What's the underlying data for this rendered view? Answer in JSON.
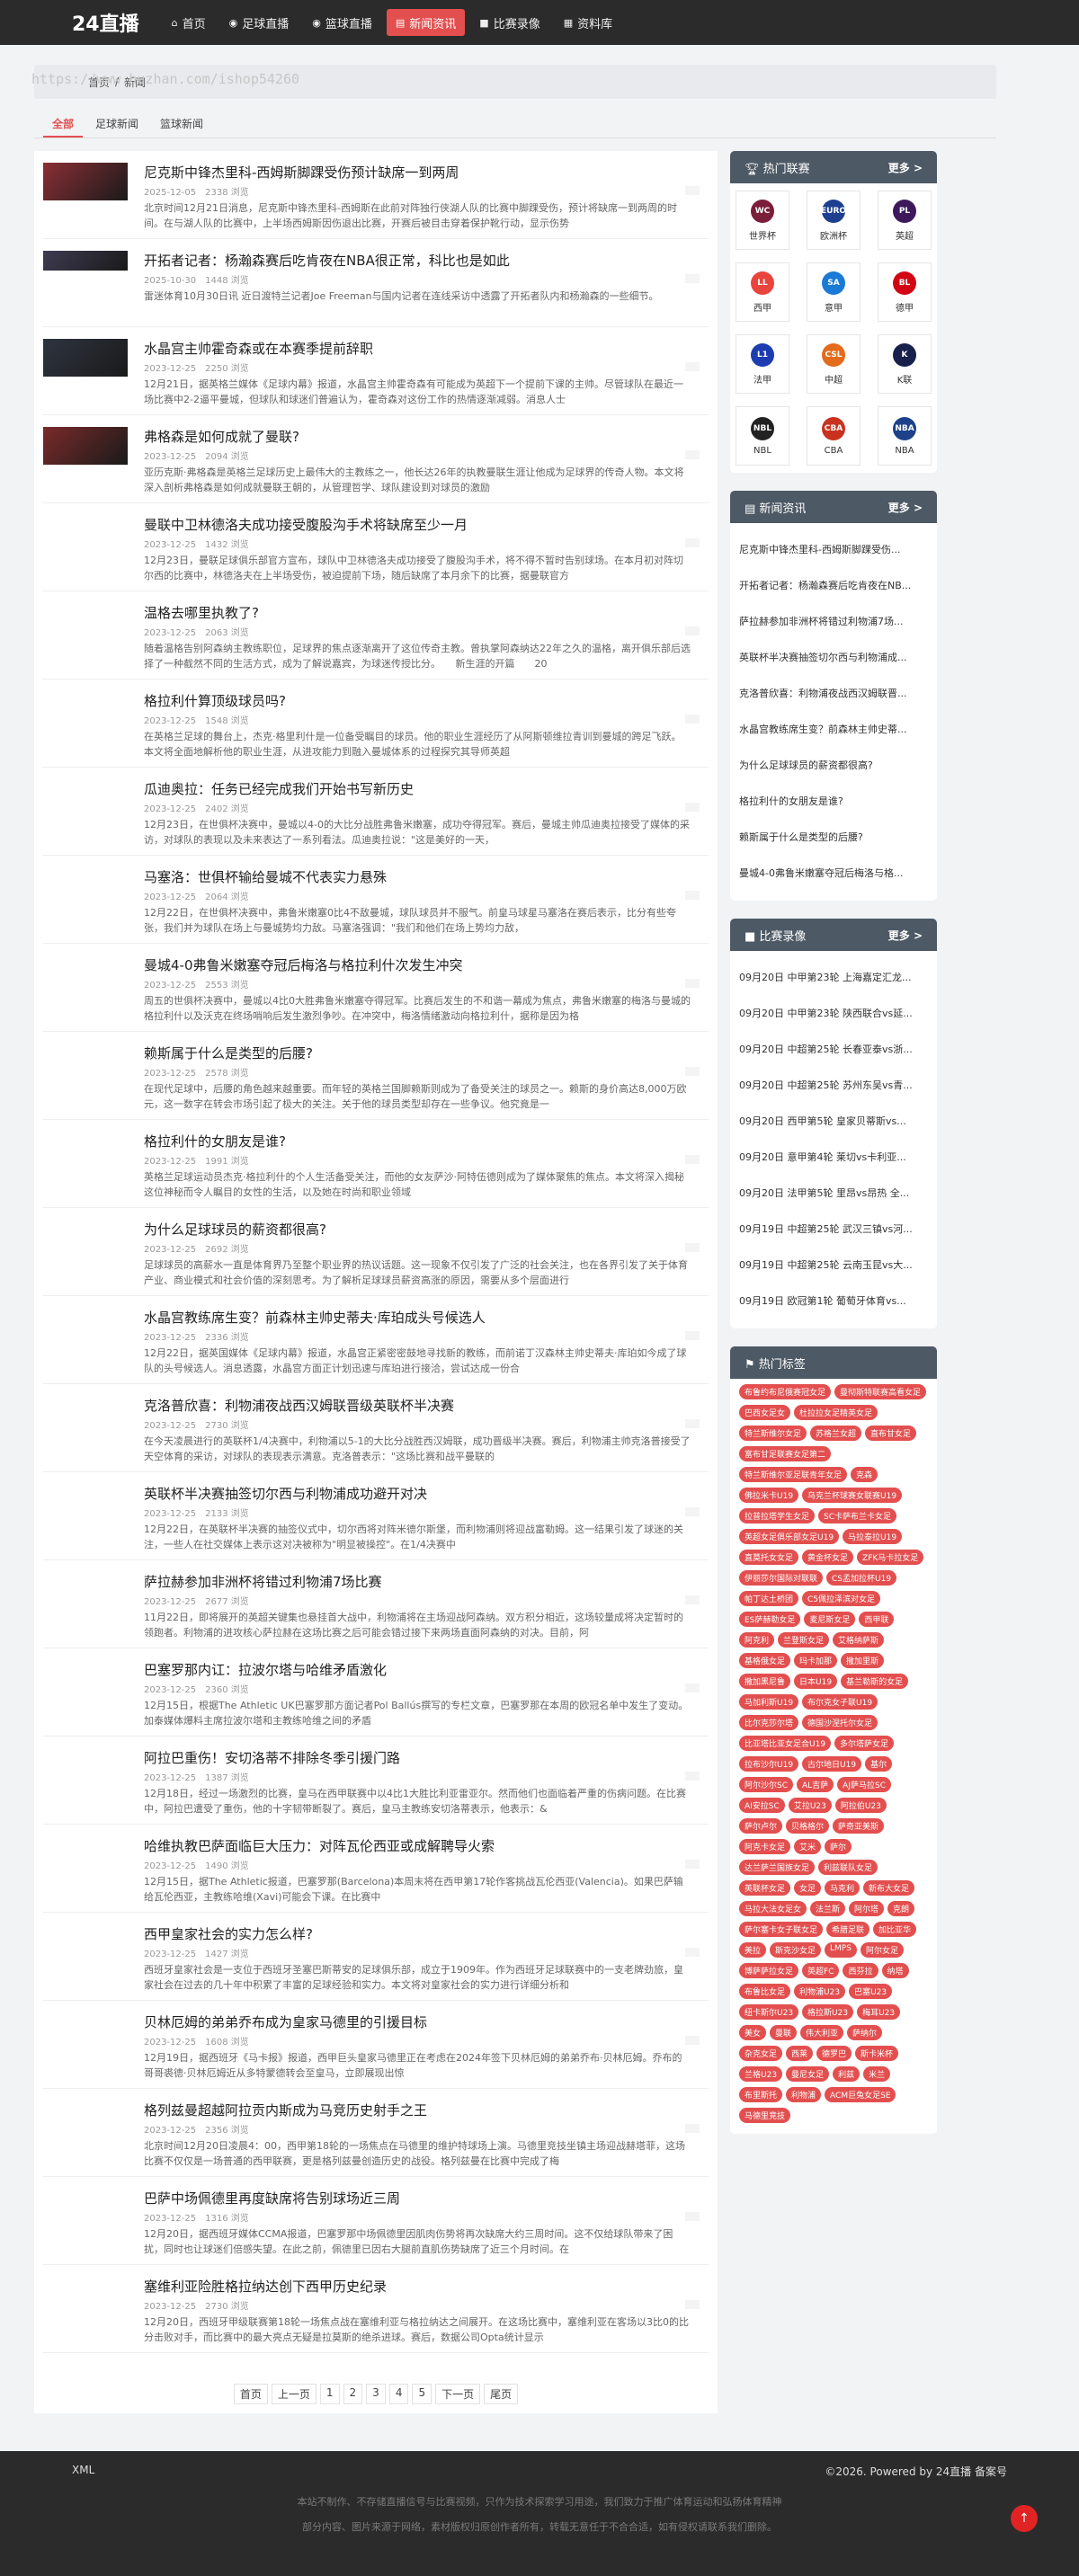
{
  "header": {
    "logo": "24直播",
    "nav": [
      {
        "label": "首页",
        "icon": "home-icon",
        "glyph": "⌂"
      },
      {
        "label": "足球直播",
        "icon": "football-icon",
        "glyph": "◉"
      },
      {
        "label": "篮球直播",
        "icon": "basketball-icon",
        "glyph": "◉"
      },
      {
        "label": "新闻资讯",
        "icon": "news-icon",
        "glyph": "▤",
        "active": true
      },
      {
        "label": "比赛录像",
        "icon": "video-icon",
        "glyph": "■"
      },
      {
        "label": "资料库",
        "icon": "database-icon",
        "glyph": "▦"
      }
    ]
  },
  "watermark": "https://www.huzhan.com/ishop54260",
  "breadcrumb": {
    "home": "首页",
    "sep": "/",
    "current": "新闻"
  },
  "tabs": [
    {
      "label": "全部",
      "active": true
    },
    {
      "label": "足球新闻"
    },
    {
      "label": "篮球新闻"
    }
  ],
  "articles": [
    {
      "title": "尼克斯中锋杰里科-西姆斯脚踝受伤预计缺席一到两周",
      "date": "2025-12-05",
      "views": "2338 浏览",
      "summary": "北京时间12月21日消息，尼克斯中锋杰里科-西姆斯在此前对阵独行侠湖人队的比赛中脚踝受伤，预计将缺席一到两周的时间。在与湖人队的比赛中，上半场西姆斯因伤退出比赛，开赛后被目击穿着保护靴行动，显示伤势",
      "thumb": "#8a2f35"
    },
    {
      "title": "开拓者记者：杨瀚森赛后吃肯夜在NBA很正常，科比也是如此",
      "date": "2025-10-30",
      "views": "1448 浏览",
      "summary": "雷迷体育10月30日讯 近日渡特兰记者Joe Freeman与国内记者在连线采访中透露了开拓者队内和杨瀚森的一些细节。",
      "thumb": "#3f3b52"
    },
    {
      "title": "水晶宫主帅霍奇森或在本赛季提前辞职",
      "date": "2023-12-25",
      "views": "2250 浏览",
      "summary": "12月21日，据英格兰媒体《足球内幕》报道，水晶宫主帅霍奇森有可能成为英超下一个提前下课的主帅。尽管球队在最近一场比赛中2-2逼平曼城，但球队和球迷们普遍认为，霍奇森对这份工作的热情逐渐减弱。消息人士",
      "thumb": "#2e3440"
    },
    {
      "title": "弗格森是如何成就了曼联?",
      "date": "2023-12-25",
      "views": "2094 浏览",
      "summary": "亚历克斯·弗格森是英格兰足球历史上最伟大的主教练之一，他长达26年的执教曼联生涯让他成为足球界的传奇人物。本文将深入剖析弗格森是如何成就曼联王朝的，从管理哲学、球队建设到对球员的激励",
      "thumb": "#7a2a2a"
    },
    {
      "title": "曼联中卫林德洛夫成功接受腹股沟手术将缺席至少一月",
      "date": "2023-12-25",
      "views": "1432 浏览",
      "summary": "12月23日，曼联足球俱乐部官方宣布，球队中卫林德洛夫成功接受了腹股沟手术，将不得不暂时告别球场。在本月初对阵切尔西的比赛中，林德洛夫在上半场受伤，被迫提前下场，随后缺席了本月余下的比赛，据曼联官方",
      "thumb": null
    },
    {
      "title": "温格去哪里执教了?",
      "date": "2023-12-25",
      "views": "2063 浏览",
      "summary": "随着温格告别阿森纳主教练职位，足球界的焦点逐渐离开了这位传奇主教。曾执掌阿森纳达22年之久的温格，离开俱乐部后选择了一种截然不同的生活方式，成为了解说嘉宾，为球迷传授比分。　　新生涯的开篇　　20",
      "thumb": null
    },
    {
      "title": "格拉利什算顶级球员吗?",
      "date": "2023-12-25",
      "views": "1548 浏览",
      "summary": "在英格兰足球的舞台上，杰克·格里利什是一位备受瞩目的球员。他的职业生涯经历了从阿斯顿维拉青训到曼城的跨足飞跃。本文将全面地解析他的职业生涯，从进攻能力到融入曼城体系的过程探究其导师英超",
      "thumb": null
    },
    {
      "title": "瓜迪奥拉：任务已经完成我们开始书写新历史",
      "date": "2023-12-25",
      "views": "2402 浏览",
      "summary": "12月23日，在世俱杯决赛中，曼城以4-0的大比分战胜弗鲁米嫩塞，成功夺得冠军。赛后，曼城主帅瓜迪奥拉接受了媒体的采访，对球队的表现以及未来表达了一系列看法。瓜迪奥拉说：\"这是美好的一天，",
      "thumb": null
    },
    {
      "title": "马塞洛：世俱杯输给曼城不代表实力悬殊",
      "date": "2023-12-25",
      "views": "2064 浏览",
      "summary": "12月22日，在世俱杯决赛中，弗鲁米嫩塞0比4不敌曼城，球队球员并不服气。前皇马球星马塞洛在赛后表示，比分有些夸张，我们并为球队在场上与曼城势均力敌。马塞洛强调：\"我们和他们在场上势均力敌，",
      "thumb": null
    },
    {
      "title": "曼城4-0弗鲁米嫩塞夺冠后梅洛与格拉利什次发生冲突",
      "date": "2023-12-25",
      "views": "2553 浏览",
      "summary": "周五的世俱杯决赛中，曼城以4比0大胜弗鲁米嫩塞夺得冠军。比赛后发生的不和谐一幕成为焦点，弗鲁米嫩塞的梅洛与曼城的格拉利什以及沃克在终场哨响后发生激烈争吵。在冲突中，梅洛情绪激动向格拉利什，据称是因为格",
      "thumb": null
    },
    {
      "title": "赖斯属于什么是类型的后腰?",
      "date": "2023-12-25",
      "views": "2578 浏览",
      "summary": "在现代足球中，后腰的角色越来越重要。而年轻的英格兰国脚赖斯则成为了备受关注的球员之一。赖斯的身价高达8,000万欧元，这一数字在转会市场引起了极大的关注。关于他的球员类型却存在一些争议。他究竟是一",
      "thumb": null
    },
    {
      "title": "格拉利什的女朋友是谁?",
      "date": "2023-12-25",
      "views": "1991 浏览",
      "summary": "英格兰足球运动员杰克·格拉利什的个人生活备受关注，而他的女友萨沙·阿特伍德则成为了媒体聚焦的焦点。本文将深入揭秘这位神秘而令人瞩目的女性的生活，以及她在时尚和职业领域",
      "thumb": null
    },
    {
      "title": "为什么足球球员的薪资都很高?",
      "date": "2023-12-25",
      "views": "2692 浏览",
      "summary": "足球球员的高薪水一直是体育界乃至整个职业界的热议话题。这一现象不仅引发了广泛的社会关注，也在各界引发了关于体育产业、商业模式和社会价值的深刻思考。为了解析足球球员薪资高涨的原因，需要从多个层面进行",
      "thumb": null
    },
    {
      "title": "水晶宫教练席生变？前森林主帅史蒂夫·库珀成头号候选人",
      "date": "2023-12-25",
      "views": "2336 浏览",
      "summary": "12月22日，据英国媒体《足球内幕》报道，水晶宫正紧密密鼓地寻找新的教练，而前诺丁汉森林主帅史蒂夫·库珀如今成了球队的头号候选人。消息透露，水晶宫方面正计划迅速与库珀进行接洽，尝试达成一份合",
      "thumb": null
    },
    {
      "title": "克洛普欣喜：利物浦夜战西汉姆联晋级英联杯半决赛",
      "date": "2023-12-25",
      "views": "2730 浏览",
      "summary": "在今天凌晨进行的英联杯1/4决赛中，利物浦以5-1的大比分战胜西汉姆联，成功晋级半决赛。赛后，利物浦主帅克洛普接受了天空体育的采访，对球队的表现表示满意。克洛普表示：\"这场比赛和战平曼联的",
      "thumb": null
    },
    {
      "title": "英联杯半决赛抽签切尔西与利物浦成功避开对决",
      "date": "2023-12-25",
      "views": "2133 浏览",
      "summary": "12月22日，在英联杯半决赛的抽签仪式中，切尔西将对阵米德尔斯堡，而利物浦则将迎战富勒姆。这一结果引发了球迷的关注，一些人在社交媒体上表示这对决被称为\"明显被操控\"。在1/4决赛中",
      "thumb": null
    },
    {
      "title": "萨拉赫参加非洲杯将错过利物浦7场比赛",
      "date": "2023-12-25",
      "views": "2677 浏览",
      "summary": "11月22日，即将展开的英超关键集也悬挂首大战中，利物浦将在主场迎战阿森纳。双方积分相近，这场较量成将决定暂时的领跑者。利物浦的进攻核心萨拉赫在这场比赛之后可能会错过接下来两场直面阿森纳的对决。目前，阿",
      "thumb": null
    },
    {
      "title": "巴塞罗那内讧：拉波尔塔与哈维矛盾激化",
      "date": "2023-12-25",
      "views": "2360 浏览",
      "summary": "12月15日，根据The Athletic UK巴塞罗那方面记者Pol Ballús撰写的专栏文章，巴塞罗那在本周的欧冠名单中发生了变动。加泰媒体爆料主席拉波尔塔和主教练哈维之间的矛盾",
      "thumb": null
    },
    {
      "title": "阿拉巴重伤！安切洛蒂不排除冬季引援门路",
      "date": "2023-12-25",
      "views": "1387 浏览",
      "summary": "12月18日，经过一场激烈的比赛，皇马在西甲联赛中以4比1大胜比利亚雷亚尔。然而他们也面临着严重的伤病问题。在比赛中，阿拉巴遭受了重伤，他的十字韧带断裂了。赛后，皇马主教练安切洛蒂表示，他表示：&",
      "thumb": null
    },
    {
      "title": "哈维执教巴萨面临巨大压力：对阵瓦伦西亚或成解聘导火索",
      "date": "2023-12-25",
      "views": "1490 浏览",
      "summary": "12月15日，据The Athletic报道，巴塞罗那(Barcelona)本周末将在西甲第17轮作客挑战瓦伦西亚(Valencia)。如果巴萨输给瓦伦西亚，主教练哈维(Xavi)可能会下课。在比赛中",
      "thumb": null
    },
    {
      "title": "西甲皇家社会的实力怎么样?",
      "date": "2023-12-25",
      "views": "1427 浏览",
      "summary": "西班牙皇家社会是一支位于西班牙圣塞巴斯蒂安的足球俱乐部，成立于1909年。作为西班牙足球联赛中的一支老牌劲旅，皇家社会在过去的几十年中积累了丰富的足球经验和实力。本文将对皇家社会的实力进行详细分析和",
      "thumb": null
    },
    {
      "title": "贝林厄姆的弟弟乔布成为皇家马德里的引援目标",
      "date": "2023-12-25",
      "views": "1608 浏览",
      "summary": "12月19日，据西班牙《马卡报》报道，西甲巨头皇家马德里正在考虑在2024年签下贝林厄姆的弟弟乔布·贝林厄姆。乔布的哥哥裘德·贝林厄姆近从多特蒙德转会至皇马，立即展现出惊",
      "thumb": null
    },
    {
      "title": "格列兹曼超越阿拉贡内斯成为马竞历史射手之王",
      "date": "2023-12-25",
      "views": "2356 浏览",
      "summary": "北京时间12月20日凌晨4：00，西甲第18轮的一场焦点在马德里的维护特球场上演。马德里竞技坐镇主场迎战赫塔菲，这场比赛不仅仅是一场普通的西甲联赛，更是格列兹曼创造历史的战役。格列兹曼在比赛中完成了梅",
      "thumb": null
    },
    {
      "title": "巴萨中场佩德里再度缺席将告别球场近三周",
      "date": "2023-12-25",
      "views": "1316 浏览",
      "summary": "12月20日，据西班牙媒体CCMA报道，巴塞罗那中场佩德里因肌肉伤势将再次缺席大约三周时间。这不仅给球队带来了困扰，同时也让球迷们倍感失望。在此之前，佩德里已因右大腿前直肌伤势缺席了近三个月时间。在",
      "thumb": null
    },
    {
      "title": "塞维利亚险胜格拉纳达创下西甲历史纪录",
      "date": "2023-12-25",
      "views": "2730 浏览",
      "summary": "12月20日，西班牙甲级联赛第18轮一场焦点战在塞维利亚与格拉纳达之间展开。在这场比赛中，塞维利亚在客场以3比0的比分击败对手，而比赛中的最大亮点无疑是拉莫斯的绝杀进球。赛后，数据公司Opta统计显示",
      "thumb": null
    }
  ],
  "pager": [
    "首页",
    "上一页",
    "1",
    "2",
    "3",
    "4",
    "5",
    "下一页",
    "尾页"
  ],
  "sidebar": {
    "hot_leagues": {
      "title": "热门联赛",
      "more": "更多 >",
      "items": [
        {
          "name": "世界杯",
          "short": "WC",
          "color": "#7b1e3a"
        },
        {
          "name": "欧洲杯",
          "short": "EURO",
          "color": "#1e3f8f"
        },
        {
          "name": "英超",
          "short": "PL",
          "color": "#3d195b"
        },
        {
          "name": "西甲",
          "short": "LL",
          "color": "#e8443d"
        },
        {
          "name": "意甲",
          "short": "SA",
          "color": "#1a7bd6"
        },
        {
          "name": "德甲",
          "short": "BL",
          "color": "#d20515"
        },
        {
          "name": "法甲",
          "short": "L1",
          "color": "#1d3cb0"
        },
        {
          "name": "中超",
          "short": "CSL",
          "color": "#e46b1c"
        },
        {
          "name": "K联",
          "short": "K",
          "color": "#16204a"
        },
        {
          "name": "NBL",
          "short": "NBL",
          "color": "#222"
        },
        {
          "name": "CBA",
          "short": "CBA",
          "color": "#c8321e"
        },
        {
          "name": "NBA",
          "short": "NBA",
          "color": "#1d428a"
        }
      ]
    },
    "news": {
      "title": "新闻资讯",
      "more": "更多 >",
      "items": [
        "尼克斯中锋杰里科-西姆斯脚踝受伤...",
        "开拓者记者：杨瀚森赛后吃肯夜在NB...",
        "萨拉赫参加非洲杯将错过利物浦7场...",
        "英联杯半决赛抽签切尔西与利物浦成...",
        "克洛普欣喜：利物浦夜战西汉姆联晋...",
        "水晶宫教练席生变？前森林主帅史蒂...",
        "为什么足球球员的薪资都很高?",
        "格拉利什的女朋友是谁?",
        "赖斯属于什么是类型的后腰?",
        "曼城4-0弗鲁米嫩塞夺冠后梅洛与格..."
      ]
    },
    "videos": {
      "title": "比赛录像",
      "more": "更多 >",
      "items": [
        "09月20日 中甲第23轮 上海嘉定汇龙...",
        "09月20日 中甲第23轮 陕西联合vs延...",
        "09月20日 中超第25轮 长春亚泰vs浙...",
        "09月20日 中超第25轮 苏州东吴vs青...",
        "09月20日 西甲第5轮 皇家贝蒂斯vs...",
        "09月20日 意甲第4轮 莱切vs卡利亚...",
        "09月20日 法甲第5轮 里昂vs昂热 全...",
        "09月19日 中超第25轮 武汉三镇vs河...",
        "09月19日 中超第25轮 云南玉昆vs大...",
        "09月19日 欧冠第1轮 葡萄牙体育vs..."
      ]
    },
    "tags": {
      "title": "热门标签",
      "items": [
        "布鲁约布尼俄赛冠女足",
        "曼彻斯特联赛高看女足",
        "巴西女足女",
        "杜拉拉女足精英女足",
        "特兰斯维尔女足",
        "苏格兰女超",
        "直布甘女足",
        "富布甘足联赛女足第二",
        "特兰斯维尔亚足联青年女足",
        "克森",
        "佛拉米卡U19",
        "乌克兰杯球赛女联赛U19",
        "拉普拉塔学生女足",
        "SC卡萨布兰卡女足",
        "英超女足俱乐部女足U19",
        "马拉泰拉U19",
        "直莫托女女足",
        "黄金杯女足",
        "ZFK马卡拉女足",
        "伊丽莎尔国际对联联",
        "CS孟加拉杯U19",
        "帕丁达土桥团",
        "C5佩拉泽滨对女足",
        "ES萨赫勒女足",
        "麦尼斯女足",
        "西甲联",
        "阿克利",
        "兰登斯女足",
        "艾格纳萨斯",
        "基格俄女足",
        "玛卡加那",
        "撒加里斯",
        "撒加黑尼鲁",
        "日本U19",
        "基兰勒斯的女足",
        "马加利斯U19",
        "布尔克女子联U19",
        "比尔克莎尔塔",
        "德国沙涅托尔女足",
        "比亚塔比亚女足合U19",
        "多尔塔萨女足",
        "拉布沙尔U19",
        "古尔地日U19",
        "基尔",
        "阿尔沙尔SC",
        "AL吉萨",
        "AJ萨马拉SC",
        "AI安拉SC",
        "艾拉U23",
        "阿拉伯U23",
        "萨尔卢尔",
        "贝格格尔",
        "萨奇亚美斯",
        "阿克卡女足",
        "艾米",
        "萨尔",
        "达兰萨兰国族女足",
        "利兹联队女足",
        "英联杯女足",
        "女足",
        "马克利",
        "新布大女足",
        "马拉大法女足女",
        "法兰斯",
        "阿尔塔",
        "克朗",
        "萨尔塞卡女子联女足",
        "希腊足联",
        "加比亚华",
        "美拉",
        "斯克沙女足",
        "LMPS",
        "阿尔女足",
        "博萨萨拉女足",
        "英超FC",
        "西芬拉",
        "纳塔",
        "布鲁比女足",
        "利物浦U23",
        "巴塞U23",
        "纽卡斯尔U23",
        "格拉斯U23",
        "梅耳U23",
        "美女",
        "曼联",
        "伟大利亚",
        "萨纳尔",
        "杂克女足",
        "西莱",
        "德罗巴",
        "斯卡米杯",
        "兰格U23",
        "曼尼女足",
        "利兹",
        "米兰",
        "布里斯托",
        "利物浦",
        "ACM巨兔女足SE",
        "马德里竞技"
      ]
    }
  },
  "footer": {
    "left": "XML",
    "right": "©2026. Powered by 24直播 备案号",
    "note1": "本站不制作、不存储直播信号与比赛视频，只作为技术探索学习用途，我们致力于推广体育运动和弘扬体育精神",
    "note2": "部分内容、图片来源于网络，素材版权归原创作者所有，转载无意任于不合合适，如有侵权请联系我们删除。",
    "totop_glyph": "↑"
  }
}
